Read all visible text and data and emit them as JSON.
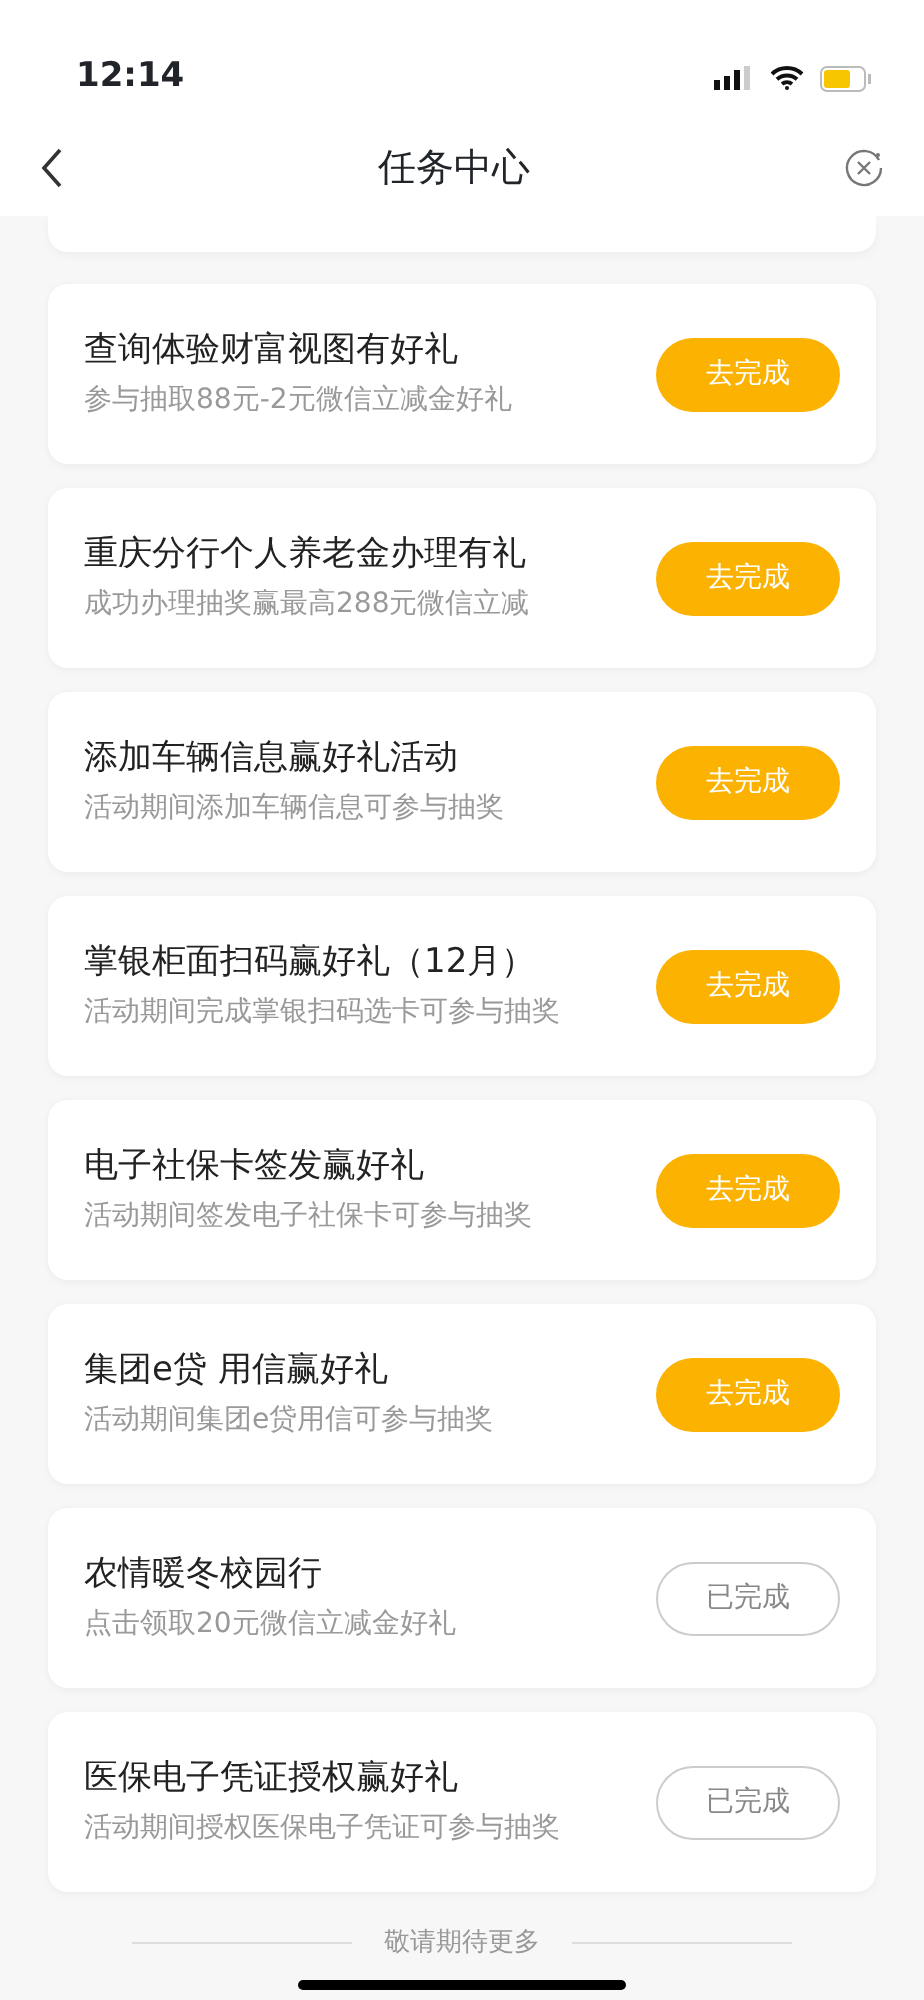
{
  "status_bar": {
    "time": "12:14"
  },
  "nav": {
    "title": "任务中心"
  },
  "tasks": [
    {
      "title": "查询体验财富视图有好礼",
      "subtitle": "参与抽取88元-2元微信立减金好礼",
      "button": "去完成",
      "completed": false
    },
    {
      "title": "重庆分行个人养老金办理有礼",
      "subtitle": "成功办理抽奖赢最高288元微信立减",
      "button": "去完成",
      "completed": false
    },
    {
      "title": "添加车辆信息赢好礼活动",
      "subtitle": "活动期间添加车辆信息可参与抽奖",
      "button": "去完成",
      "completed": false
    },
    {
      "title": "掌银柜面扫码赢好礼（12月）",
      "subtitle": "活动期间完成掌银扫码选卡可参与抽奖",
      "button": "去完成",
      "completed": false
    },
    {
      "title": "电子社保卡签发赢好礼",
      "subtitle": "活动期间签发电子社保卡可参与抽奖",
      "button": "去完成",
      "completed": false
    },
    {
      "title": "集团e贷 用信赢好礼",
      "subtitle": "活动期间集团e贷用信可参与抽奖",
      "button": "去完成",
      "completed": false
    },
    {
      "title": "农情暖冬校园行",
      "subtitle": "点击领取20元微信立减金好礼",
      "button": "已完成",
      "completed": true
    },
    {
      "title": "医保电子凭证授权赢好礼",
      "subtitle": "活动期间授权医保电子凭证可参与抽奖",
      "button": "已完成",
      "completed": true
    }
  ],
  "footer": "敬请期待更多"
}
